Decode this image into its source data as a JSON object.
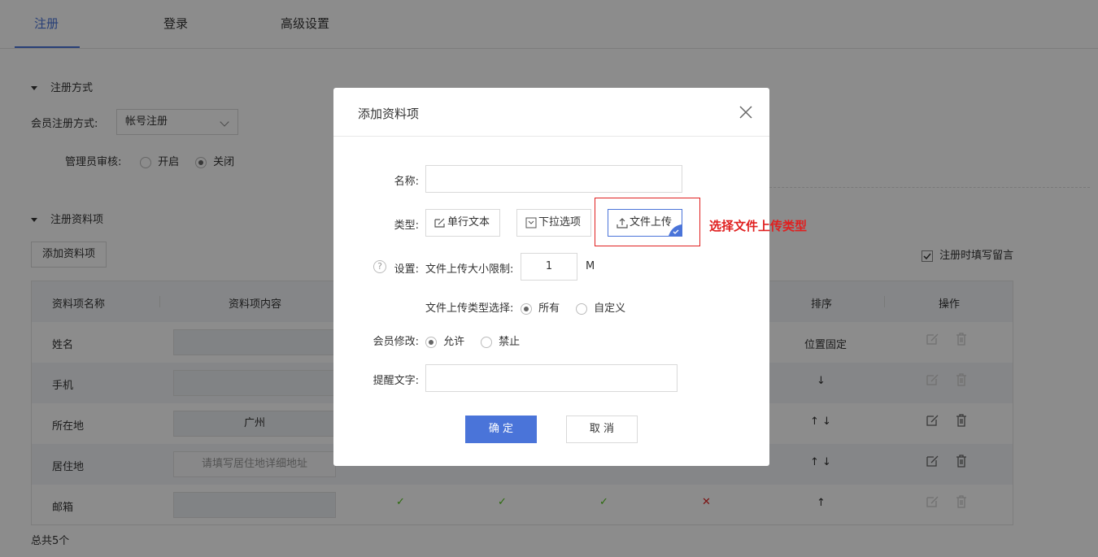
{
  "tabs": [
    {
      "label": "注册"
    },
    {
      "label": "登录"
    },
    {
      "label": "高级设置"
    }
  ],
  "reg_method": {
    "title": "注册方式",
    "member_label": "会员注册方式:",
    "member_value": "帐号注册",
    "admin_label": "管理员审核:",
    "opt_on": "开启",
    "opt_off": "关闭"
  },
  "reg_items": {
    "title": "注册资料项",
    "add_button": "添加资料项",
    "fill_message": "注册时填写留言",
    "headers": [
      "资料项名称",
      "资料项内容",
      "排序",
      "操作"
    ],
    "rows": [
      {
        "name": "姓名",
        "content": "",
        "sort": "位置固定"
      },
      {
        "name": "手机",
        "content": "",
        "sort": "↓"
      },
      {
        "name": "所在地",
        "content": "广州",
        "sort": "↑ ↓"
      },
      {
        "name": "居住地",
        "content": "请填写居住地详细地址",
        "sort": "↑ ↓"
      },
      {
        "name": "邮箱",
        "content": "",
        "sort": "↑"
      }
    ],
    "last_row_marks": [
      "✓",
      "✓",
      "✓",
      "✕"
    ],
    "total": "总共5个"
  },
  "modal": {
    "title": "添加资料项",
    "name_label": "名称:",
    "name_value": "",
    "type_label": "类型:",
    "types": [
      "单行文本",
      "下拉选项",
      "文件上传"
    ],
    "selected_type": "文件上传",
    "annotation": "选择文件上传类型",
    "settings_label": "设置:",
    "size_limit_label": "文件上传大小限制:",
    "size_limit_value": "1",
    "size_unit": "M",
    "filetype_label": "文件上传类型选择:",
    "filetype_all": "所有",
    "filetype_custom": "自定义",
    "member_edit_label": "会员修改:",
    "member_edit_allow": "允许",
    "member_edit_forbid": "禁止",
    "hint_label": "提醒文字:",
    "hint_value": "",
    "confirm": "确 定",
    "cancel": "取 消"
  },
  "colors": {
    "accent": "#4a74d9",
    "annotation": "#e02020",
    "check": "#52c41a",
    "cross": "#e02020"
  }
}
